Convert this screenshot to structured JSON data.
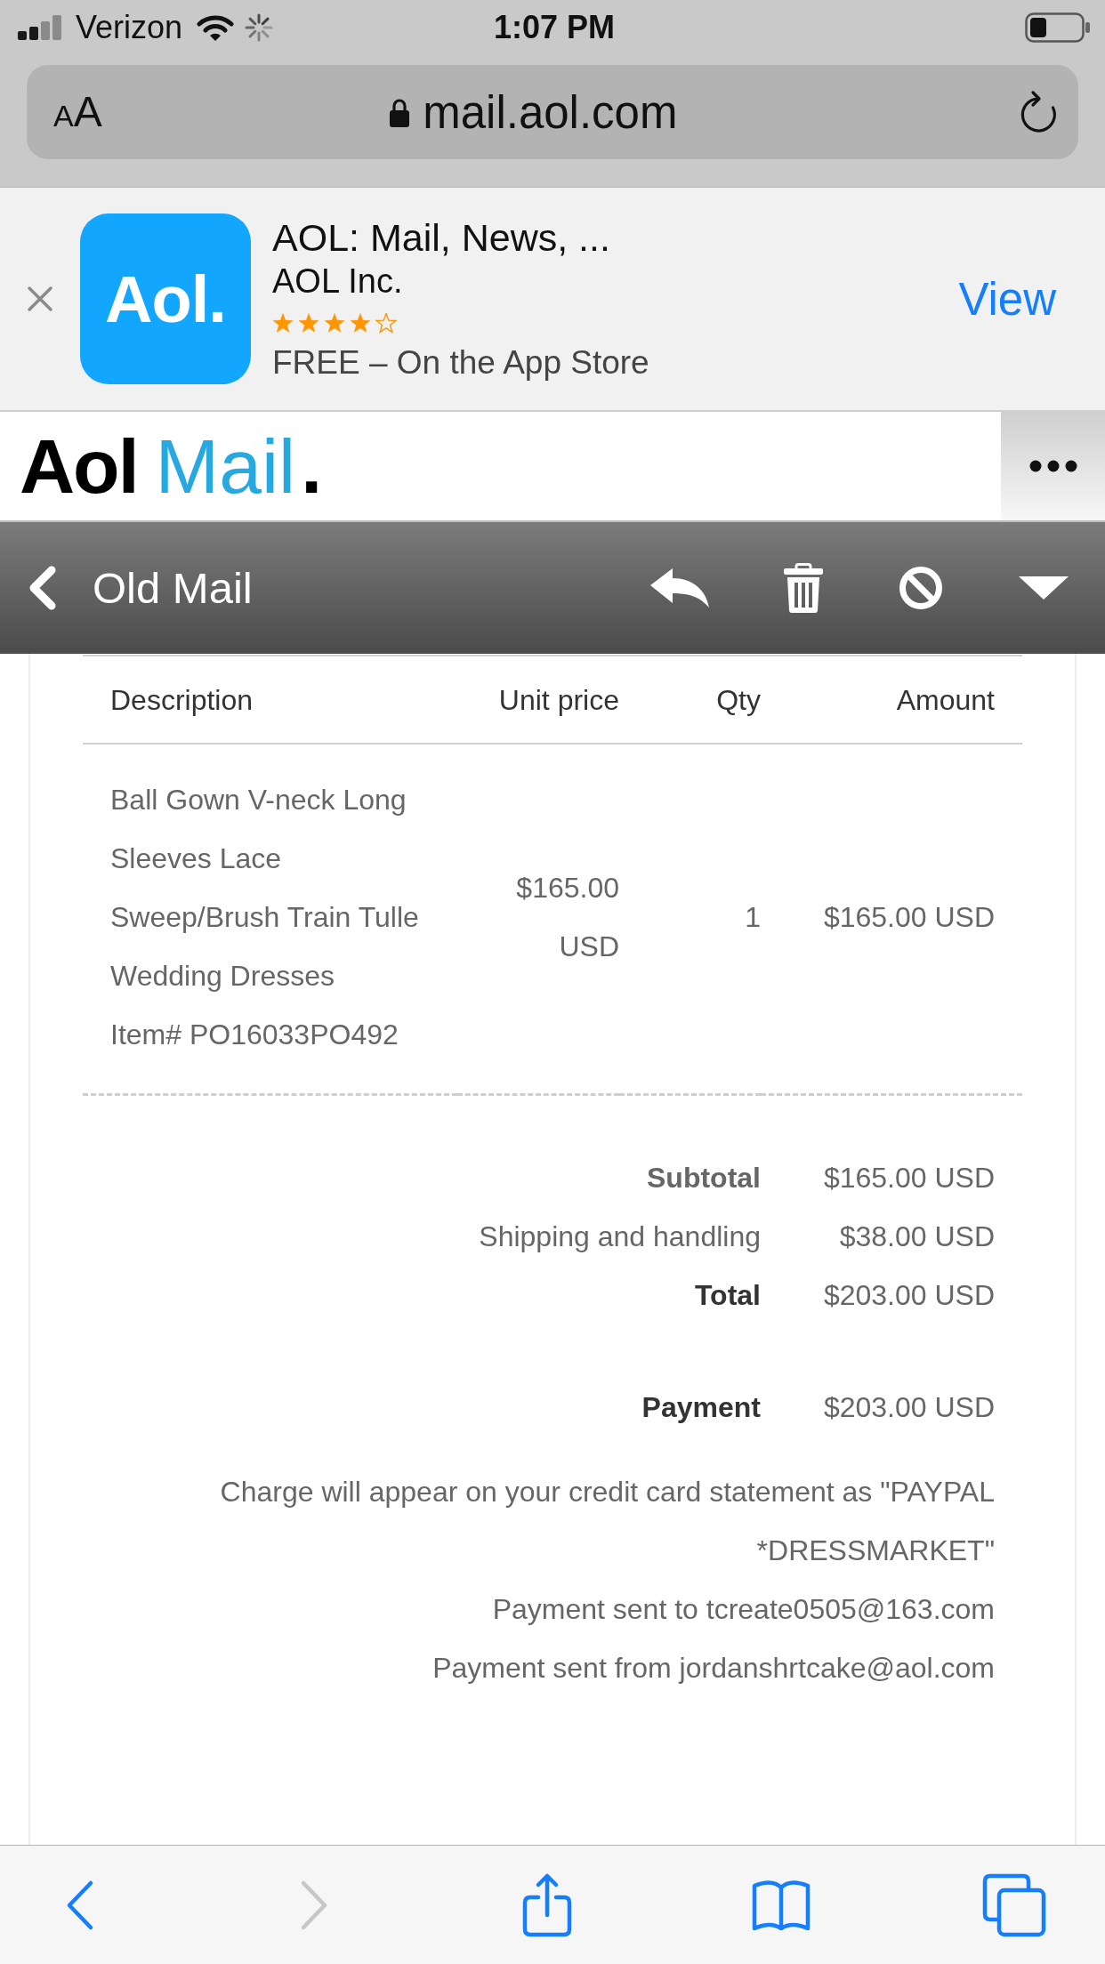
{
  "status_bar": {
    "carrier": "Verizon",
    "time": "1:07 PM"
  },
  "address_bar": {
    "text_size_button": "AA",
    "url": "mail.aol.com"
  },
  "app_banner": {
    "app_icon_label": "Aol.",
    "title": "AOL: Mail, News, ...",
    "developer": "AOL Inc.",
    "stars": 4,
    "price": "FREE – On the App Store",
    "action": "View"
  },
  "mail_header": {
    "logo_brand": "Aol",
    "logo_product": "Mail",
    "logo_mark": "."
  },
  "mail_toolbar": {
    "back_label": "Old Mail"
  },
  "invoice": {
    "columns": [
      "Description",
      "Unit price",
      "Qty",
      "Amount"
    ],
    "rows": [
      {
        "description": "Ball Gown V-neck Long Sleeves Lace Sweep/Brush Train Tulle Wedding Dresses",
        "item_number": "Item# PO16033PO492",
        "unit_price": "$165.00 USD",
        "qty": "1",
        "amount": "$165.00 USD"
      }
    ],
    "totals": [
      {
        "kind": "subtotal",
        "label": "Subtotal",
        "value": "$165.00 USD"
      },
      {
        "kind": "plain",
        "label": "Shipping and handling",
        "value": "$38.00 USD"
      },
      {
        "kind": "total",
        "label": "Total",
        "value": "$203.00 USD"
      }
    ],
    "payment": {
      "label": "Payment",
      "value": "$203.00 USD"
    },
    "notes": [
      "Charge will appear on your credit card statement as \"PAYPAL *DRESSMARKET\"",
      "Payment sent to tcreate0505@163.com",
      "Payment sent from jordanshrtcake@aol.com"
    ]
  },
  "bottom_toolbar": [
    {
      "kind": "back",
      "disabled": false
    },
    {
      "kind": "forward",
      "disabled": true
    },
    {
      "kind": "share",
      "disabled": false
    },
    {
      "kind": "bookmarks",
      "disabled": false
    },
    {
      "kind": "tabs",
      "disabled": false
    }
  ]
}
